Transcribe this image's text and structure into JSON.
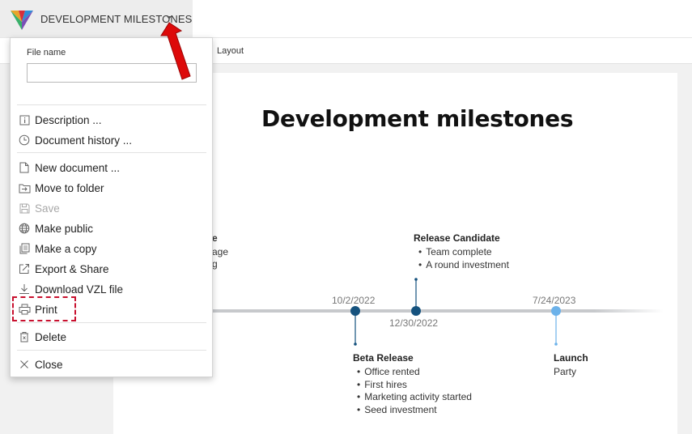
{
  "header": {
    "title": "DEVELOPMENT MILESTONES"
  },
  "toolbar": {
    "layout_tab": "Layout"
  },
  "menu": {
    "file_name_label": "File name",
    "file_name_value": "",
    "items": [
      {
        "label": "Description ...",
        "icon": "info-icon"
      },
      {
        "label": "Document history ...",
        "icon": "clock-icon"
      },
      {
        "label": "New document ...",
        "icon": "new-document-icon"
      },
      {
        "label": "Move to folder",
        "icon": "move-to-folder-icon"
      },
      {
        "label": "Save",
        "icon": "save-icon",
        "disabled": true
      },
      {
        "label": "Make public",
        "icon": "globe-icon"
      },
      {
        "label": "Make a copy",
        "icon": "copy-icon"
      },
      {
        "label": "Export & Share",
        "icon": "export-icon"
      },
      {
        "label": "Download VZL file",
        "icon": "download-icon"
      },
      {
        "label": "Print",
        "icon": "printer-icon"
      },
      {
        "label": "Delete",
        "icon": "trash-icon"
      },
      {
        "label": "Close",
        "icon": "close-icon"
      }
    ]
  },
  "canvas": {
    "title": "Development milestones",
    "clipped_milestone": {
      "title_fragment": "e",
      "line1_fragment": "age",
      "line2_fragment": "g"
    },
    "milestones": [
      {
        "title": "Release Candidate",
        "date": "12/30/2022",
        "items": [
          "Team complete",
          "A round investment"
        ]
      },
      {
        "title": "Beta Release",
        "date": "10/2/2022",
        "items": [
          "Office rented",
          "First hires",
          "Marketing activity started",
          "Seed investment"
        ]
      },
      {
        "title": "Launch",
        "date": "7/24/2023",
        "note": "Party"
      }
    ]
  },
  "colors": {
    "milestone_dark": "#15527e",
    "milestone_light": "#6cb2ea",
    "timeline": "#c7c9cc",
    "highlight": "#c8102e",
    "arrow": "#dd0a0a"
  }
}
